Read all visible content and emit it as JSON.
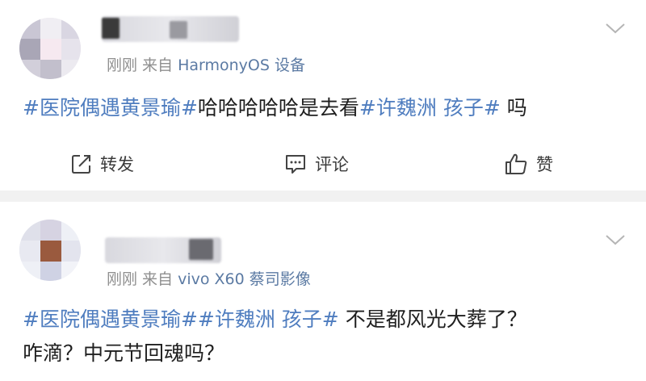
{
  "posts": [
    {
      "meta_prefix": "刚刚  来自 ",
      "device": "HarmonyOS 设备",
      "content": {
        "tag1": "#医院偶遇黄景瑜#",
        "text1": "哈哈哈哈哈是去看",
        "tag2": "#许魏洲 孩子#",
        "text2": " 吗"
      },
      "actions": {
        "repost": "转发",
        "comment": "评论",
        "like": "赞"
      }
    },
    {
      "meta_prefix": "刚刚  来自 ",
      "device": "vivo X60 蔡司影像",
      "content": {
        "tag1": "#医院偶遇黄景瑜#",
        "tag2": "#许魏洲 孩子#",
        "text1": " 不是都风光大葬了？",
        "text2": "咋滴？中元节回魂吗？"
      }
    }
  ],
  "icons": {
    "repost": "repost-icon",
    "comment": "comment-icon",
    "like": "thumbs-up-icon",
    "menu": "chevron-down-icon"
  },
  "colors": {
    "hashtag": "#4f7dbf",
    "meta": "#8f8f8f",
    "device": "#5b7aa3",
    "divider": "#f1f1f1"
  }
}
